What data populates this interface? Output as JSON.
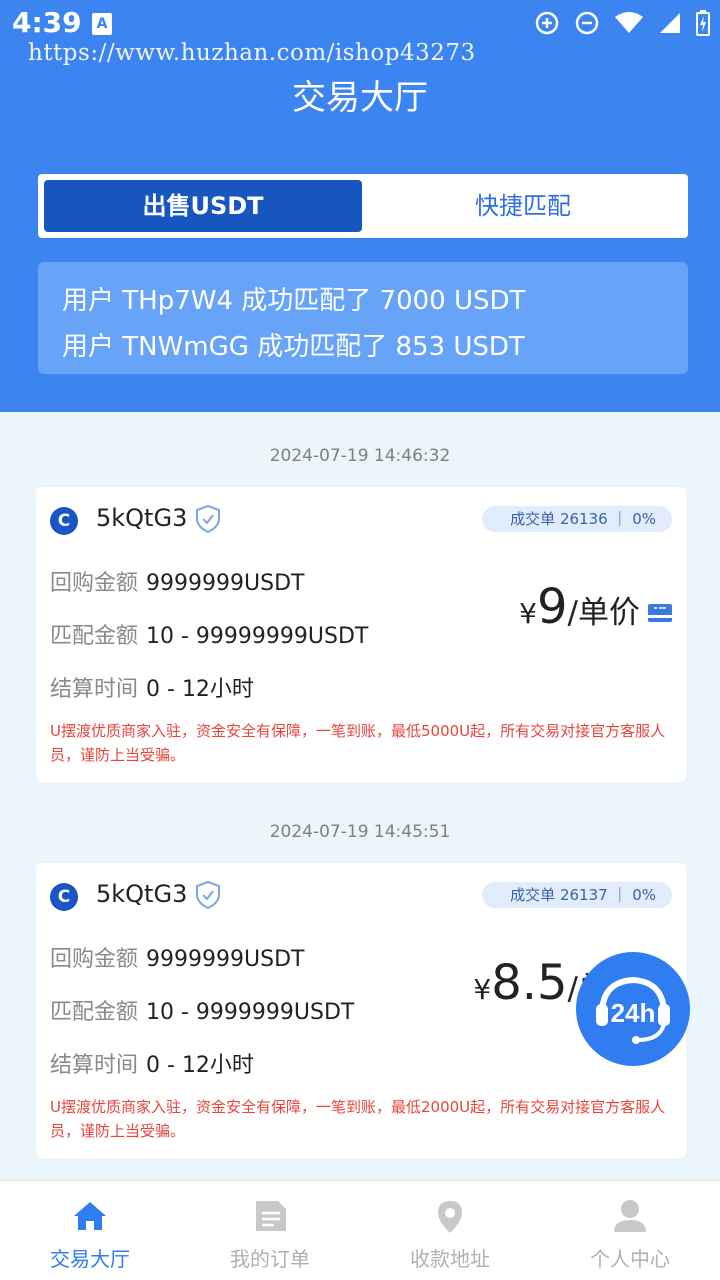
{
  "status_bar": {
    "time": "4:39",
    "notification_glyph": "A"
  },
  "watermark": "https://www.huzhan.com/ishop43273",
  "page_title": "交易大厅",
  "tabs": [
    {
      "label": "出售USDT",
      "active": true
    },
    {
      "label": "快捷匹配",
      "active": false
    }
  ],
  "notices": [
    "用户 THp7W4 成功匹配了 7000 USDT",
    "用户 TNWmGG 成功匹配了 853 USDT"
  ],
  "listings": [
    {
      "timestamp": "2024-07-19 14:46:32",
      "coin_glyph": "C",
      "merchant": "5kQtG3",
      "deal_badge": "成交单 26136 ｜ 0%",
      "buyback_label": "回购金额",
      "buyback_value": "9999999USDT",
      "match_label": "匹配金额",
      "match_value": "10 - 99999999USDT",
      "settle_label": "结算时间",
      "settle_value": "0 - 12小时",
      "currency_symbol": "¥",
      "price": "9",
      "price_unit": "/单价",
      "disclaimer": "U摆渡优质商家入驻，资金安全有保障，一笔到账，最低5000U起，所有交易对接官方客服人员，谨防上当受骗。"
    },
    {
      "timestamp": "2024-07-19 14:45:51",
      "coin_glyph": "C",
      "merchant": "5kQtG3",
      "deal_badge": "成交单 26137 ｜ 0%",
      "buyback_label": "回购金额",
      "buyback_value": "9999999USDT",
      "match_label": "匹配金额",
      "match_value": "10 - 9999999USDT",
      "settle_label": "结算时间",
      "settle_value": "0 - 12小时",
      "currency_symbol": "¥",
      "price": "8.5",
      "price_unit": "/单价",
      "disclaimer": "U摆渡优质商家入驻，资金安全有保障，一笔到账，最低2000U起，所有交易对接官方客服人员，谨防上当受骗。"
    }
  ],
  "support_button": {
    "label": "24h"
  },
  "bottom_nav": [
    {
      "label": "交易大厅",
      "icon": "home-icon",
      "active": true
    },
    {
      "label": "我的订单",
      "icon": "document-icon",
      "active": false
    },
    {
      "label": "收款地址",
      "icon": "location-pin-icon",
      "active": false
    },
    {
      "label": "个人中心",
      "icon": "user-icon",
      "active": false
    }
  ],
  "colors": {
    "header_blue": "#3c85f0",
    "tab_active": "#1656be",
    "accent": "#2f7df0",
    "warning_text": "#e8453c",
    "page_bg": "#eaf5fc"
  }
}
